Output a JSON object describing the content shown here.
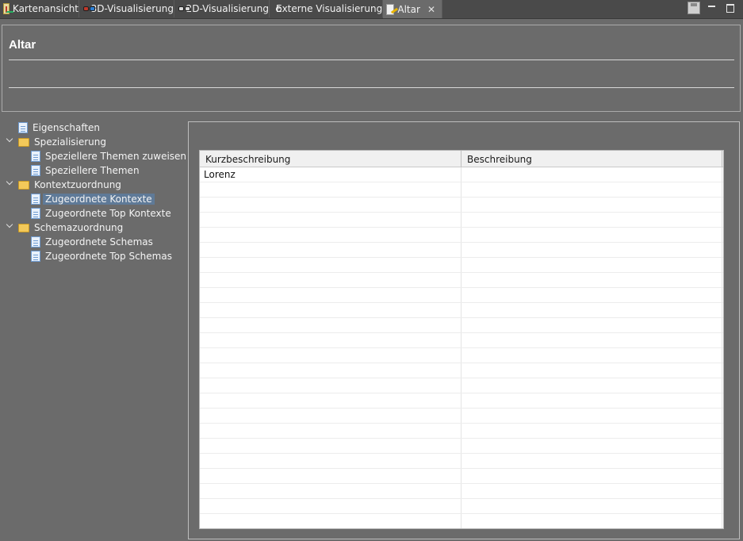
{
  "tabs": [
    {
      "label": "Kartenansicht",
      "icon": "map-icon"
    },
    {
      "label": "3D-Visualisierung",
      "icon": "3d-glasses-icon"
    },
    {
      "label": "2D-Visualisierung",
      "icon": "2d-glasses-icon"
    },
    {
      "label": "Externe Visualisierung",
      "icon": "external-visualization-icon"
    },
    {
      "label": "Altar",
      "icon": "editor-icon",
      "active": true,
      "close": "✕"
    }
  ],
  "window_controls": {
    "save": "save-icon",
    "minimize": "minimize-icon",
    "maximize": "maximize-icon"
  },
  "header": {
    "title": "Altar"
  },
  "tree": [
    {
      "label": "Eigenschaften",
      "type": "document",
      "level": 0
    },
    {
      "label": "Spezialisierung",
      "type": "folder",
      "level": 0,
      "expanded": true
    },
    {
      "label": "Speziellere Themen zuweisen",
      "type": "document",
      "level": 1
    },
    {
      "label": "Speziellere Themen",
      "type": "document",
      "level": 1
    },
    {
      "label": "Kontextzuordnung",
      "type": "folder",
      "level": 0,
      "expanded": true
    },
    {
      "label": "Zugeordnete Kontexte",
      "type": "document",
      "level": 1,
      "selected": true
    },
    {
      "label": "Zugeordnete Top Kontexte",
      "type": "document",
      "level": 1
    },
    {
      "label": "Schemazuordnung",
      "type": "folder",
      "level": 0,
      "expanded": true
    },
    {
      "label": "Zugeordnete Schemas",
      "type": "document",
      "level": 1
    },
    {
      "label": "Zugeordnete Top Schemas",
      "type": "document",
      "level": 1
    }
  ],
  "table": {
    "columns": [
      "Kurzbeschreibung",
      "Beschreibung"
    ],
    "rows": [
      [
        "Lorenz",
        ""
      ]
    ]
  },
  "colors": {
    "background": "#6b6b6b",
    "tab_bar": "#4a4a4a",
    "selection": "#5f7a98",
    "table_background": "#ffffff"
  }
}
